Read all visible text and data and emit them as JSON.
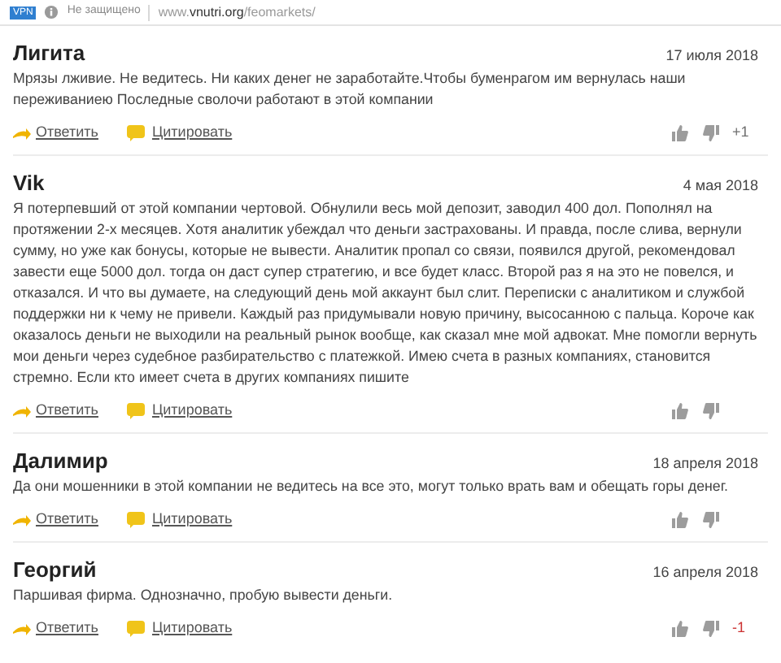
{
  "address_bar": {
    "vpn_badge": "VPN",
    "security": "Не защищено",
    "url_prefix": "www.",
    "url_domain": "vnutri.org",
    "url_path": "/feomarkets/"
  },
  "comments": [
    {
      "author": "Лигита",
      "date": "17 июля 2018",
      "text": "Мрязы лживие. Не ведитесь. Ни каких денег не заработайте.Чтобы буменрагом им вернулась наши переживаниею Последные сволочи работают в этой компании",
      "reply": "Ответить",
      "quote": "Цитировать",
      "votes": {
        "score": "+1",
        "color": "#707070"
      }
    },
    {
      "author": "Vik",
      "date": "4 мая 2018",
      "text": "Я потерпевший от этой компании чертовой. Обнулили весь мой депозит, заводил 400 дол. Пополнял на протяжении 2-х месяцев. Хотя аналитик убеждал что деньги застрахованы. И правда, после слива, вернули сумму, но уже как бонусы, которые не вывести. Аналитик пропал со связи, появился другой, рекомендовал завести еще 5000 дол. тогда он даст супер стратегию, и все будет класс. Второй раз я на это не повелся, и отказался. И что вы думаете, на следующий день мой аккаунт был слит. Переписки с аналитиком и службой поддержки ни к чему не привели. Каждый раз придумывали новую причину, высосанною с пальца. Короче как оказалось деньги не выходили на реальный рынок вообще, как сказал мне мой адвокат. Мне помогли вернуть мои деньги через судебное разбирательство с платежкой. Имею счета в разных компаниях, становится стремно. Если кто имеет счета в других компаниях пишите",
      "reply": "Ответить",
      "quote": "Цитировать"
    },
    {
      "author": "Далимир",
      "date": "18 апреля 2018",
      "text": "Да они мошенники в этой компании не ведитесь на все это, могут только врать вам и обещать горы денег.",
      "reply": "Ответить",
      "quote": "Цитировать"
    },
    {
      "author": "Георгий",
      "date": "16 апреля 2018",
      "text": "Паршивая фирма. Однозначно, пробую вывести деньги.",
      "reply": "Ответить",
      "quote": "Цитировать",
      "votes": {
        "score": "-1",
        "color": "#cc3333"
      }
    }
  ]
}
